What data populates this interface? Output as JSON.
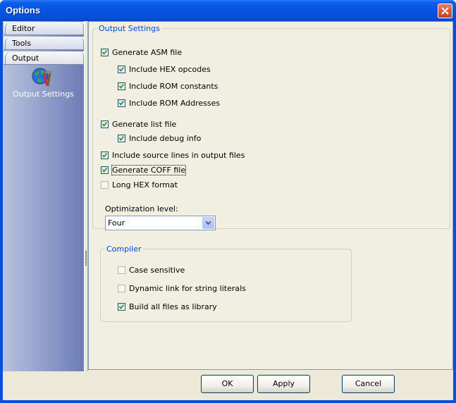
{
  "window": {
    "title": "Options"
  },
  "nav": {
    "tabs": [
      {
        "label": "Editor",
        "active": false
      },
      {
        "label": "Tools",
        "active": false
      },
      {
        "label": "Output",
        "active": true
      }
    ],
    "items": [
      {
        "label": "Output Settings",
        "icon": "globe-tools-icon"
      }
    ]
  },
  "output_settings": {
    "legend": "Output Settings",
    "options": [
      {
        "label": "Generate ASM file",
        "checked": true
      },
      {
        "label": "Include HEX opcodes",
        "checked": true
      },
      {
        "label": "Include ROM constants",
        "checked": true
      },
      {
        "label": "Include ROM Addresses",
        "checked": true
      },
      {
        "label": "Generate list file",
        "checked": true
      },
      {
        "label": "Include debug info",
        "checked": true
      },
      {
        "label": "Include source lines in output files",
        "checked": true
      },
      {
        "label": "Generate COFF file",
        "checked": true
      },
      {
        "label": "Long HEX format",
        "checked": false
      }
    ],
    "optimization_label": "Optimization level:",
    "optimization_value": "Four"
  },
  "compiler": {
    "legend": "Compiler",
    "options": [
      {
        "label": "Case sensitive",
        "checked": false
      },
      {
        "label": "Dynamic link for string literals",
        "checked": false
      },
      {
        "label": "Build all files as library",
        "checked": true
      }
    ]
  },
  "buttons": {
    "ok": "OK",
    "apply": "Apply",
    "cancel": "Cancel"
  },
  "colors": {
    "title_bar": "#0554dc",
    "group_legend": "#0046d5",
    "nav_gradient_end": "#6c7cb6"
  }
}
